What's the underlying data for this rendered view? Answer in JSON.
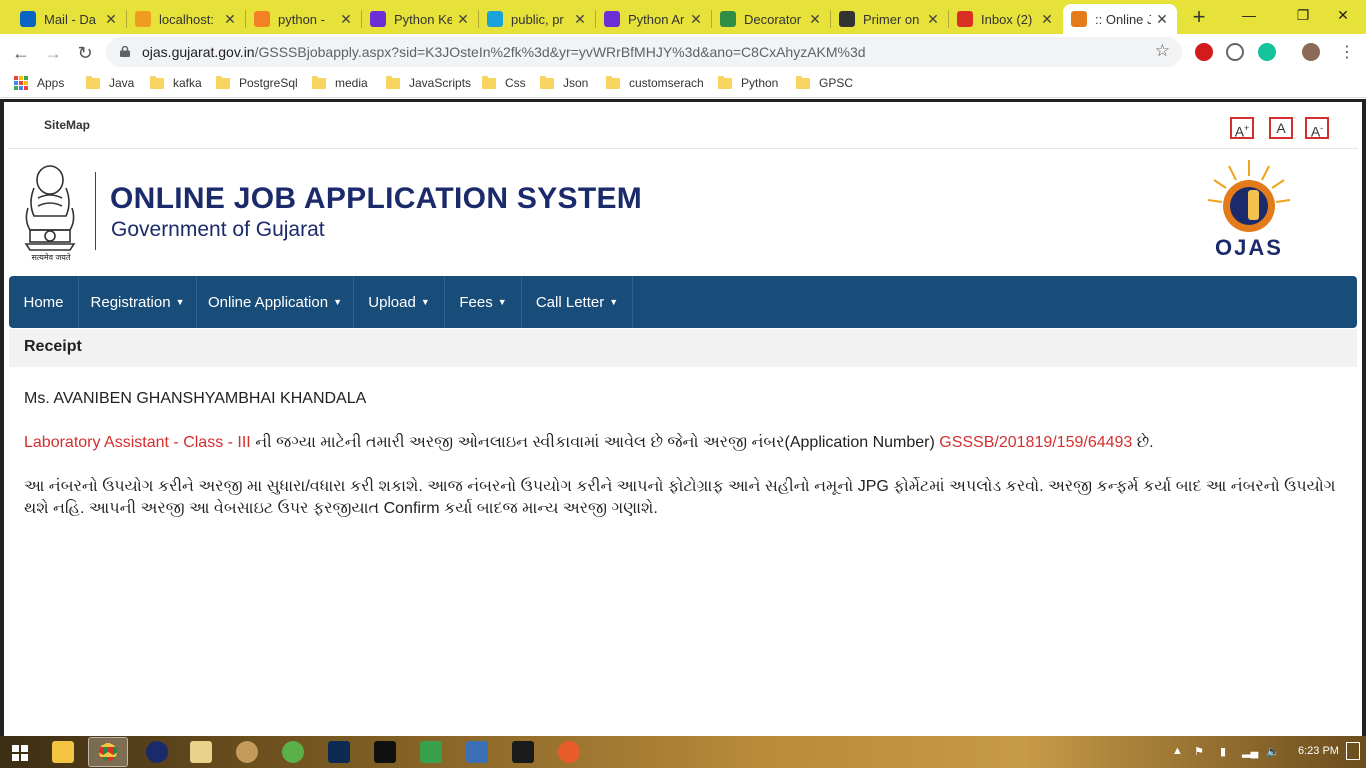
{
  "browser": {
    "tabs": [
      {
        "title": "Mail - Da",
        "icon": "outlook-icon",
        "color": "#0a64c4",
        "active": false
      },
      {
        "title": "localhost:",
        "icon": "document-icon",
        "color": "#f29c1f",
        "active": false
      },
      {
        "title": "python - ",
        "icon": "stackoverflow-icon",
        "color": "#f48024",
        "active": false
      },
      {
        "title": "Python Ke",
        "icon": "p-icon",
        "color": "#6b2fd6",
        "active": false
      },
      {
        "title": "public, pr",
        "icon": "t-icon",
        "color": "#1aa3d8",
        "active": false
      },
      {
        "title": "Python Ar",
        "icon": "p-icon",
        "color": "#6b2fd6",
        "active": false
      },
      {
        "title": "Decorator",
        "icon": "gfg-icon",
        "color": "#2f8d46",
        "active": false
      },
      {
        "title": "Primer on",
        "icon": "realpython-icon",
        "color": "#333333",
        "active": false
      },
      {
        "title": "Inbox (2)",
        "icon": "gmail-icon",
        "color": "#d93025",
        "active": false
      },
      {
        "title": ":: Online J",
        "icon": "ojas-icon",
        "color": "#e37b1b",
        "active": true
      }
    ],
    "url_host": "ojas.gujarat.gov.in",
    "url_path": "/GSSSBjobapply.aspx?sid=K3JOsteIn%2fk%3d&yr=yvWRrBfMHJY%3d&ano=C8CxAhyzAKM%3d",
    "bookmarks": [
      "Apps",
      "Java",
      "kafka",
      "PostgreSql",
      "media",
      "JavaScripts",
      "Css",
      "Json",
      "customserach",
      "Python",
      "GPSC"
    ]
  },
  "page": {
    "sitemap": "SiteMap",
    "font_buttons": {
      "increase": "A",
      "increase_sup": "+",
      "normal": "A",
      "decrease": "A",
      "decrease_sup": "-"
    },
    "emblem_caption": "सत्यमेव जयते",
    "title": "ONLINE JOB APPLICATION SYSTEM",
    "subtitle": "Government of Gujarat",
    "logo_text": "OJAS",
    "nav": [
      {
        "label": "Home",
        "dropdown": false
      },
      {
        "label": "Registration",
        "dropdown": true
      },
      {
        "label": "Online Application",
        "dropdown": true
      },
      {
        "label": "Upload",
        "dropdown": true
      },
      {
        "label": "Fees",
        "dropdown": true
      },
      {
        "label": "Call Letter",
        "dropdown": true
      }
    ],
    "section_title": "Receipt",
    "applicant_name": "Ms. AVANIBEN GHANSHYAMBHAI KHANDALA",
    "post_name": "Laboratory Assistant - Class - III",
    "line1_middle": " ની જગ્યા માટેની તમારી અરજી ઓનલાઇન સ્વીકાવામાં આવેલ છે જેનો અરજી નંબર(Application Number) ",
    "application_number": "GSSSB/201819/159/64493",
    "line1_end": " છે.",
    "paragraph": "આ નંબરનો ઉપયોગ કરીને અરજી મા સુધારા/વધારા કરી શકાશે. આજ નંબરનો ઉપયોગ કરીને આપનો ફોટોગ્રાફ આને સહીનો નમૂનો JPG ફોર્મેટમાં અપલોડ કરવો. અરજી કન્ફર્મ કર્યા બાદ આ નંબરનો ઉપયોગ થશે નહિ. આપની અરજી આ વેબસાઇટ ઉપર ફરજીયાત Confirm કર્યા બાદજ માન્ય અરજી ગણાશે."
  },
  "taskbar": {
    "clock": "6:23 PM"
  }
}
